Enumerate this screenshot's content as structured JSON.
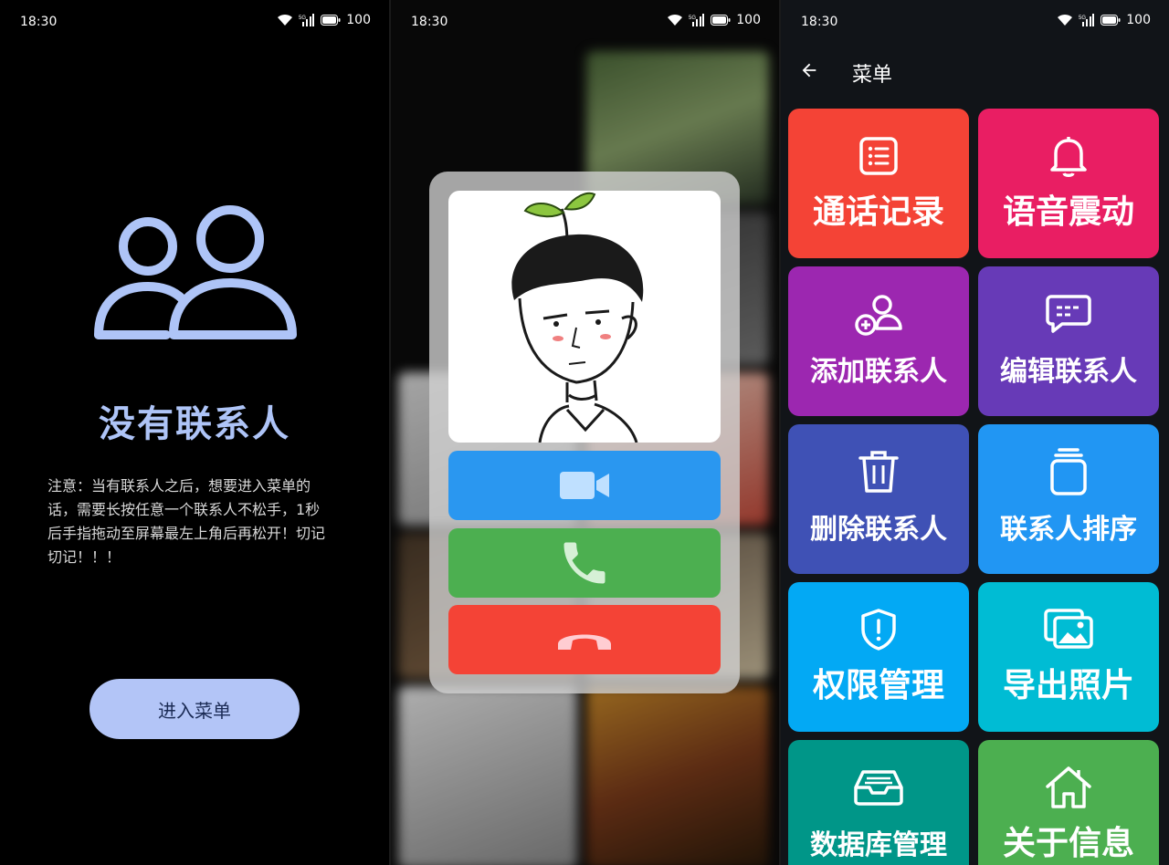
{
  "status": {
    "time": "18:30",
    "battery": "100",
    "network": "5G"
  },
  "screen1": {
    "empty_title": "没有联系人",
    "note": "注意：当有联系人之后，想要进入菜单的话，需要长按任意一个联系人不松手，1秒后手指拖动至屏幕最左上角后再松开！切记切记！！！",
    "enter_menu_label": "进入菜单",
    "colors": {
      "accent": "#aec4f7",
      "button": "#b3c5f7"
    }
  },
  "screen2": {
    "buttons": [
      {
        "name": "video-call",
        "icon": "video-camera-icon",
        "color": "#2a97f0"
      },
      {
        "name": "voice-call",
        "icon": "phone-icon",
        "color": "#4caf50"
      },
      {
        "name": "hang-up",
        "icon": "phone-hangup-icon",
        "color": "#f44336"
      }
    ]
  },
  "screen3": {
    "title": "菜单",
    "items": [
      {
        "label": "通话记录",
        "icon": "list-icon",
        "color": "#f44336"
      },
      {
        "label": "语音震动",
        "icon": "bell-icon",
        "color": "#e91e63"
      },
      {
        "label": "添加联系人",
        "icon": "add-person-icon",
        "color": "#9c27b0"
      },
      {
        "label": "编辑联系人",
        "icon": "message-icon",
        "color": "#673ab7"
      },
      {
        "label": "删除联系人",
        "icon": "trash-icon",
        "color": "#3f51b5"
      },
      {
        "label": "联系人排序",
        "icon": "stack-icon",
        "color": "#2196f3"
      },
      {
        "label": "权限管理",
        "icon": "shield-alert-icon",
        "color": "#03a9f4"
      },
      {
        "label": "导出照片",
        "icon": "photos-icon",
        "color": "#00bcd4"
      },
      {
        "label": "数据库管理",
        "icon": "inbox-icon",
        "color": "#009688"
      },
      {
        "label": "关于信息",
        "icon": "home-icon",
        "color": "#4caf50"
      }
    ]
  }
}
